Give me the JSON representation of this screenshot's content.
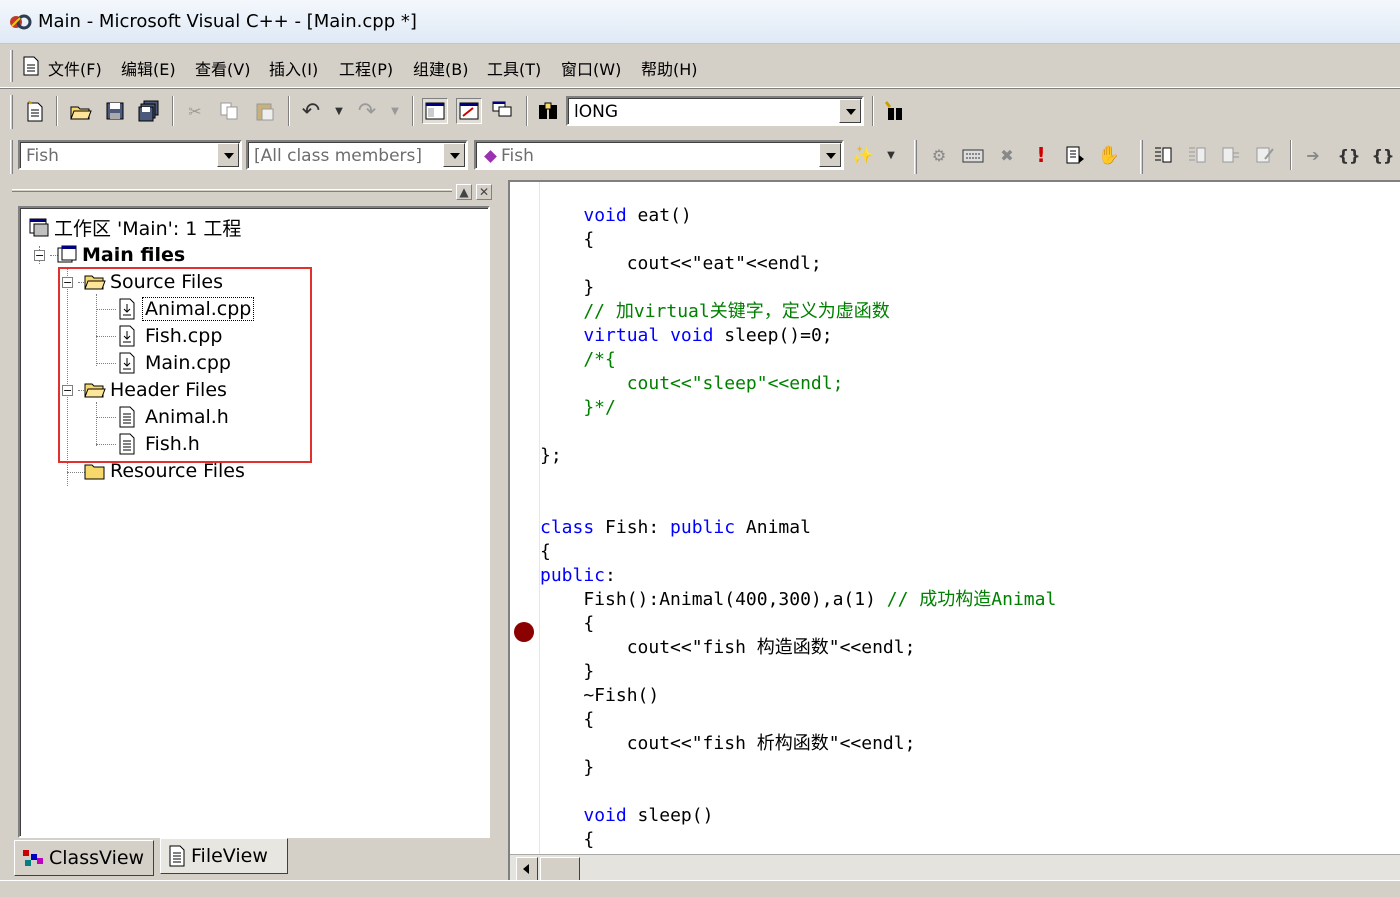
{
  "window": {
    "title": "Main - Microsoft Visual C++ - [Main.cpp *]"
  },
  "menu": [
    "文件(F)",
    "编辑(E)",
    "查看(V)",
    "插入(I)",
    "工程(P)",
    "组建(B)",
    "工具(T)",
    "窗口(W)",
    "帮助(H)"
  ],
  "toolbar": {
    "find_value": "lONG",
    "class_combo": "Fish",
    "filter_combo": "[All class members]",
    "member_combo": "Fish"
  },
  "workspace": {
    "root": "工作区 'Main': 1 工程",
    "project": "Main files",
    "source_folder": "Source Files",
    "source_files": [
      "Animal.cpp",
      "Fish.cpp",
      "Main.cpp"
    ],
    "header_folder": "Header Files",
    "header_files": [
      "Animal.h",
      "Fish.h"
    ],
    "resource_folder": "Resource Files",
    "tabs": {
      "classview": "ClassView",
      "fileview": "FileView"
    }
  },
  "code": [
    [
      {
        "t": "    "
      },
      {
        "t": "void",
        "c": "kw"
      },
      {
        "t": " eat()"
      }
    ],
    [
      {
        "t": "    {"
      }
    ],
    [
      {
        "t": "        cout<<\"eat\"<<endl;"
      }
    ],
    [
      {
        "t": "    }"
      }
    ],
    [
      {
        "t": "    // 加virtual关键字，定义为虚函数",
        "c": "cm"
      }
    ],
    [
      {
        "t": "    "
      },
      {
        "t": "virtual",
        "c": "kw"
      },
      {
        "t": " "
      },
      {
        "t": "void",
        "c": "kw"
      },
      {
        "t": " sleep()=0;"
      }
    ],
    [
      {
        "t": "    /*{",
        "c": "cm"
      }
    ],
    [
      {
        "t": "        cout<<\"sleep\"<<endl;",
        "c": "cm"
      }
    ],
    [
      {
        "t": "    }*/",
        "c": "cm"
      }
    ],
    [
      {
        "t": ""
      }
    ],
    [
      {
        "t": "};"
      }
    ],
    [
      {
        "t": ""
      }
    ],
    [
      {
        "t": ""
      }
    ],
    [
      {
        "t": "class",
        "c": "kw"
      },
      {
        "t": " Fish: "
      },
      {
        "t": "public",
        "c": "kw"
      },
      {
        "t": " Animal"
      }
    ],
    [
      {
        "t": "{"
      }
    ],
    [
      {
        "t": "public",
        "c": "kw"
      },
      {
        "t": ":"
      }
    ],
    [
      {
        "t": "    Fish():Animal(400,300),a(1) "
      },
      {
        "t": "// 成功构造Animal",
        "c": "cm"
      }
    ],
    [
      {
        "t": "    {"
      }
    ],
    [
      {
        "t": "        cout<<\"fish 构造函数\"<<endl;"
      }
    ],
    [
      {
        "t": "    }"
      }
    ],
    [
      {
        "t": "    ~Fish()"
      }
    ],
    [
      {
        "t": "    {"
      }
    ],
    [
      {
        "t": "        cout<<\"fish 析构函数\"<<endl;"
      }
    ],
    [
      {
        "t": "    }"
      }
    ],
    [
      {
        "t": ""
      }
    ],
    [
      {
        "t": "    "
      },
      {
        "t": "void",
        "c": "kw"
      },
      {
        "t": " sleep()"
      }
    ],
    [
      {
        "t": "    {"
      }
    ]
  ],
  "breakpoint_line": 17,
  "colors": {
    "keyword": "#0000ff",
    "comment": "#008000",
    "breakpoint": "#8b0000",
    "highlight_box": "#e0312c"
  }
}
